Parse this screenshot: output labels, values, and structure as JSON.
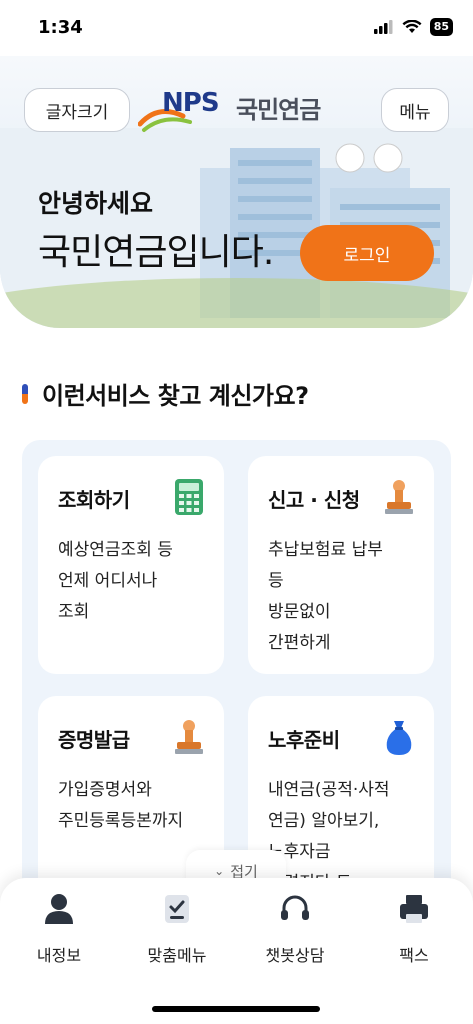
{
  "status_bar": {
    "time": "1:34",
    "battery": "85"
  },
  "header": {
    "font_size_label": "글자크기",
    "menu_label": "메뉴",
    "logo_text": "NPS",
    "logo_kor": "국민연금"
  },
  "hero": {
    "greeting": "안녕하세요",
    "headline": "국민연금입니다.",
    "login_label": "로그인"
  },
  "section": {
    "title": "이런서비스 찾고 계신가요?"
  },
  "cards": [
    {
      "title": "조회하기",
      "desc": "예상연금조회 등\n언제 어디서나\n조회",
      "icon": "calculator-icon"
    },
    {
      "title": "신고 · 신청",
      "desc": "추납보험료 납부\n등\n방문없이\n간편하게",
      "icon": "stamp-icon"
    },
    {
      "title": "증명발급",
      "desc": "가입증명서와\n주민등록등본까지",
      "icon": "stamp-icon"
    },
    {
      "title": "노후준비",
      "desc": "내연금(공적·사적\n연금) 알아보기,\n노후자금\n마련지다 드",
      "icon": "money-bag-icon"
    }
  ],
  "fold": {
    "label": "접기"
  },
  "bottom_nav": [
    {
      "label": "내정보",
      "icon": "person-icon"
    },
    {
      "label": "맞춤메뉴",
      "icon": "checklist-icon"
    },
    {
      "label": "챗봇상담",
      "icon": "headset-icon"
    },
    {
      "label": "팩스",
      "icon": "fax-icon"
    }
  ],
  "colors": {
    "accent": "#f07318",
    "brand": "#1f3a8a",
    "card_bg": "#eef4fb"
  }
}
